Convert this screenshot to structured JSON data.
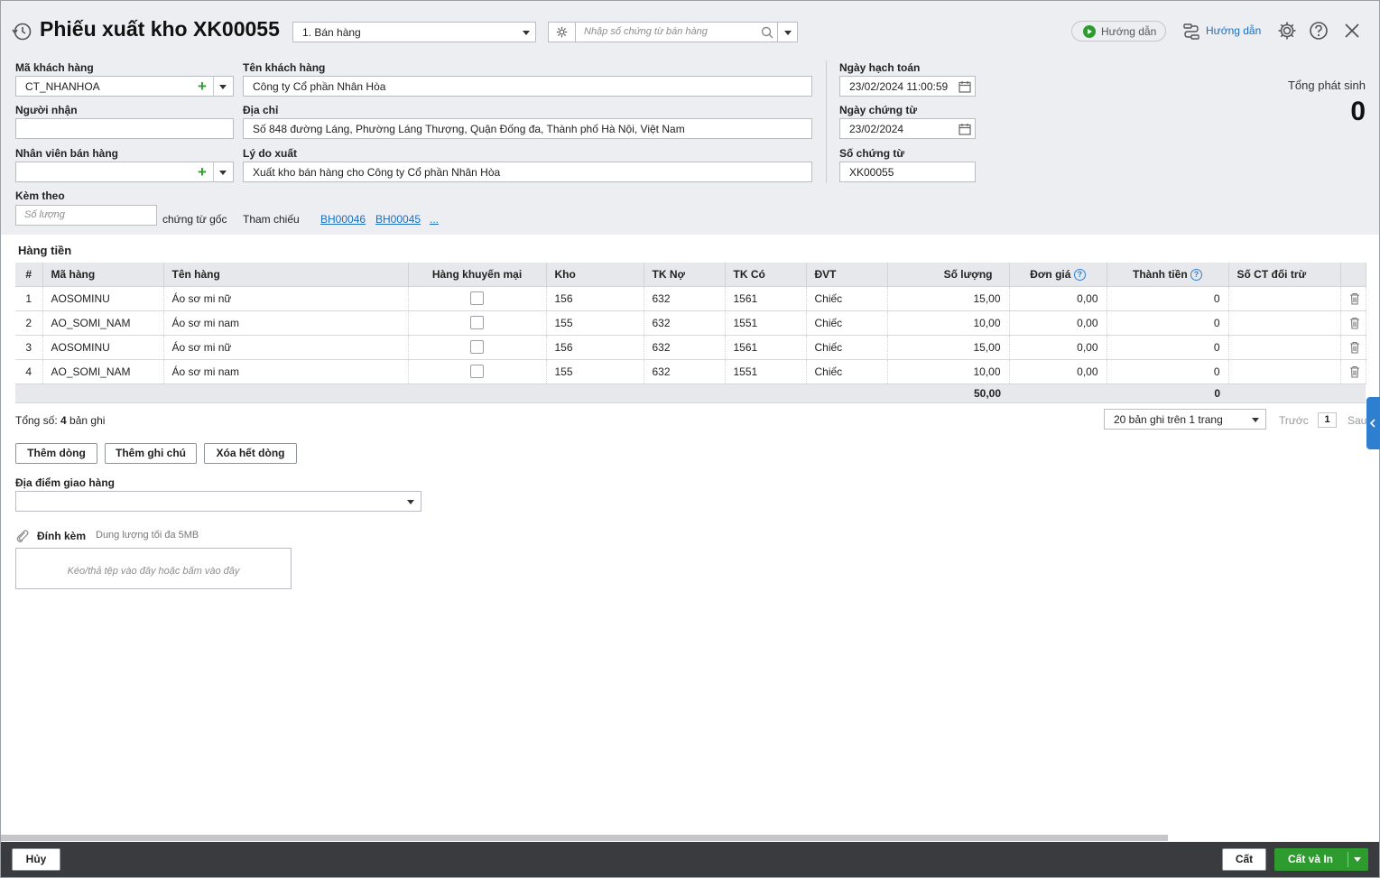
{
  "header": {
    "title": "Phiếu xuất kho XK00055",
    "type_select": "1. Bán hàng",
    "search_placeholder": "Nhập số chứng từ bán hàng",
    "guide_video": "Hướng dẫn",
    "guide_link": "Hướng dẫn"
  },
  "form": {
    "customer_code_label": "Mã khách hàng",
    "customer_code": "CT_NHANHOA",
    "customer_name_label": "Tên khách hàng",
    "customer_name": "Công ty Cổ phần Nhân Hòa",
    "receiver_label": "Người nhận",
    "receiver": "",
    "address_label": "Địa chỉ",
    "address": "Số 848 đường Láng, Phường Láng Thượng, Quận Đống đa, Thành phố Hà Nội, Việt Nam",
    "salesperson_label": "Nhân viên bán hàng",
    "salesperson": "",
    "reason_label": "Lý do xuất",
    "reason": "Xuất kho bán hàng cho Công ty Cổ phần Nhân Hòa",
    "attach_label": "Kèm theo",
    "attach_placeholder": "Số lượng",
    "original_docs": "chứng từ gốc",
    "reference_label": "Tham chiếu",
    "references": [
      "BH00046",
      "BH00045"
    ],
    "reference_more": "...",
    "posting_date_label": "Ngày hạch toán",
    "posting_date": "23/02/2024 11:00:59",
    "doc_date_label": "Ngày chứng từ",
    "doc_date": "23/02/2024",
    "doc_no_label": "Số chứng từ",
    "doc_no": "XK00055",
    "total_label": "Tổng phát sinh",
    "total_value": "0"
  },
  "grid": {
    "section_title": "Hàng tiền",
    "columns": [
      "#",
      "Mã hàng",
      "Tên hàng",
      "Hàng khuyến mại",
      "Kho",
      "TK Nợ",
      "TK Có",
      "ĐVT",
      "Số lượng",
      "Đơn giá",
      "Thành tiền",
      "Số CT đối trừ"
    ],
    "rows": [
      {
        "no": "1",
        "code": "AOSOMINU",
        "name": "Áo sơ mi nữ",
        "warehouse": "156",
        "debit": "632",
        "credit": "1561",
        "unit": "Chiếc",
        "qty": "15,00",
        "price": "0,00",
        "amount": "0",
        "offset": ""
      },
      {
        "no": "2",
        "code": "AO_SOMI_NAM",
        "name": "Áo sơ mi nam",
        "warehouse": "155",
        "debit": "632",
        "credit": "1551",
        "unit": "Chiếc",
        "qty": "10,00",
        "price": "0,00",
        "amount": "0",
        "offset": ""
      },
      {
        "no": "3",
        "code": "AOSOMINU",
        "name": "Áo sơ mi nữ",
        "warehouse": "156",
        "debit": "632",
        "credit": "1561",
        "unit": "Chiếc",
        "qty": "15,00",
        "price": "0,00",
        "amount": "0",
        "offset": ""
      },
      {
        "no": "4",
        "code": "AO_SOMI_NAM",
        "name": "Áo sơ mi nam",
        "warehouse": "155",
        "debit": "632",
        "credit": "1551",
        "unit": "Chiếc",
        "qty": "10,00",
        "price": "0,00",
        "amount": "0",
        "offset": ""
      }
    ],
    "total_qty": "50,00",
    "total_amount": "0",
    "record_count_prefix": "Tổng số: ",
    "record_count": "4",
    "record_count_suffix": " bản ghi",
    "page_size": "20 bản ghi trên 1 trang",
    "prev": "Trước",
    "page": "1",
    "next": "Sau"
  },
  "actions": {
    "add_row": "Thêm dòng",
    "add_note": "Thêm ghi chú",
    "delete_all": "Xóa hết dòng"
  },
  "delivery": {
    "label": "Địa điểm giao hàng",
    "value": ""
  },
  "attachment": {
    "label": "Đính kèm",
    "limit": "Dung lượng tối đa 5MB",
    "dropzone": "Kéo/thả tệp vào đây hoặc bấm vào đây"
  },
  "footer": {
    "cancel": "Hủy",
    "save": "Cất",
    "save_print": "Cất và In"
  },
  "colors": {
    "accent": "#2f7fd1",
    "primary_green": "#2e9b2e",
    "footer_bg": "#3a3b3f"
  }
}
